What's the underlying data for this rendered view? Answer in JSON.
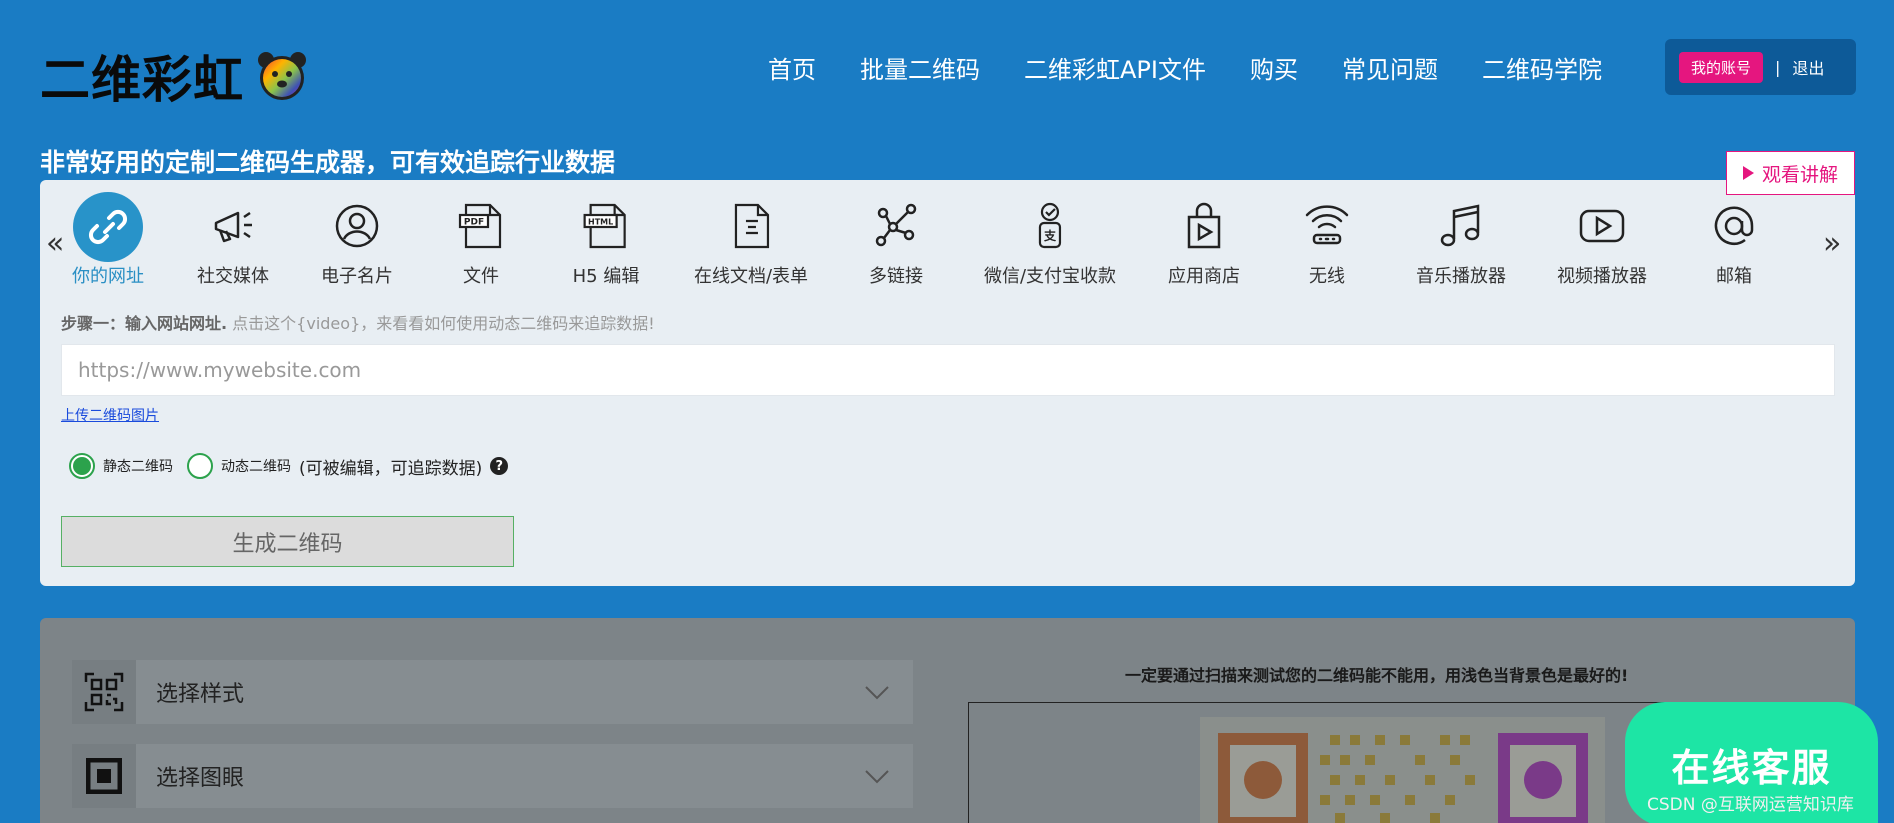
{
  "brand": {
    "name": "二维彩虹"
  },
  "nav": [
    "首页",
    "批量二维码",
    "二维彩虹API文件",
    "购买",
    "常见问题",
    "二维码学院"
  ],
  "account": {
    "my_account": "我的账号",
    "separator": "|",
    "logout": "退出"
  },
  "tagline": "非常好用的定制二维码生成器，可有效追踪行业数据",
  "watch_button": "观看讲解",
  "types": [
    {
      "label": "你的网址",
      "icon": "link-icon",
      "active": true
    },
    {
      "label": "社交媒体",
      "icon": "megaphone-icon"
    },
    {
      "label": "电子名片",
      "icon": "user-icon"
    },
    {
      "label": "文件",
      "icon": "pdf-icon"
    },
    {
      "label": "H5 编辑",
      "icon": "html-icon"
    },
    {
      "label": "在线文档/表单",
      "icon": "document-icon"
    },
    {
      "label": "多链接",
      "icon": "multilink-icon"
    },
    {
      "label": "微信/支付宝收款",
      "icon": "payment-icon"
    },
    {
      "label": "应用商店",
      "icon": "app-store-icon"
    },
    {
      "label": "无线",
      "icon": "wifi-icon"
    },
    {
      "label": "音乐播放器",
      "icon": "music-icon"
    },
    {
      "label": "视频播放器",
      "icon": "video-icon"
    },
    {
      "label": "邮箱",
      "icon": "email-icon"
    }
  ],
  "nav_arrows": {
    "prev": "«",
    "next": "»"
  },
  "step": {
    "title": "步骤一：输入网站网址.",
    "hint": " 点击这个{video}，来看看如何使用动态二维码来追踪数据!"
  },
  "url_input": {
    "placeholder": "https://www.mywebsite.com",
    "value": ""
  },
  "upload_link": "上传二维码图片",
  "qr_mode": {
    "static_label": "静态二维码",
    "dynamic_label": "动态二维码",
    "dynamic_hint": "(可被编辑，可追踪数据)",
    "help": "?",
    "selected": "static"
  },
  "generate_button": "生成二维码",
  "accordion": [
    {
      "label": "选择样式",
      "icon": "qr-style-icon"
    },
    {
      "label": "选择图眼",
      "icon": "qr-eye-icon"
    }
  ],
  "warning": "一定要通过扫描来测试您的二维码能不能用，用浅色当背景色是最好的!",
  "chat_button": "在线客服",
  "watermark": "CSDN @互联网运营知识库",
  "colors": {
    "background": "#1a7cc4",
    "accent_pink": "#e5167f",
    "active_blue": "#2893c9",
    "radio_green": "#2ca24c",
    "chat_green": "#1de5a5"
  }
}
